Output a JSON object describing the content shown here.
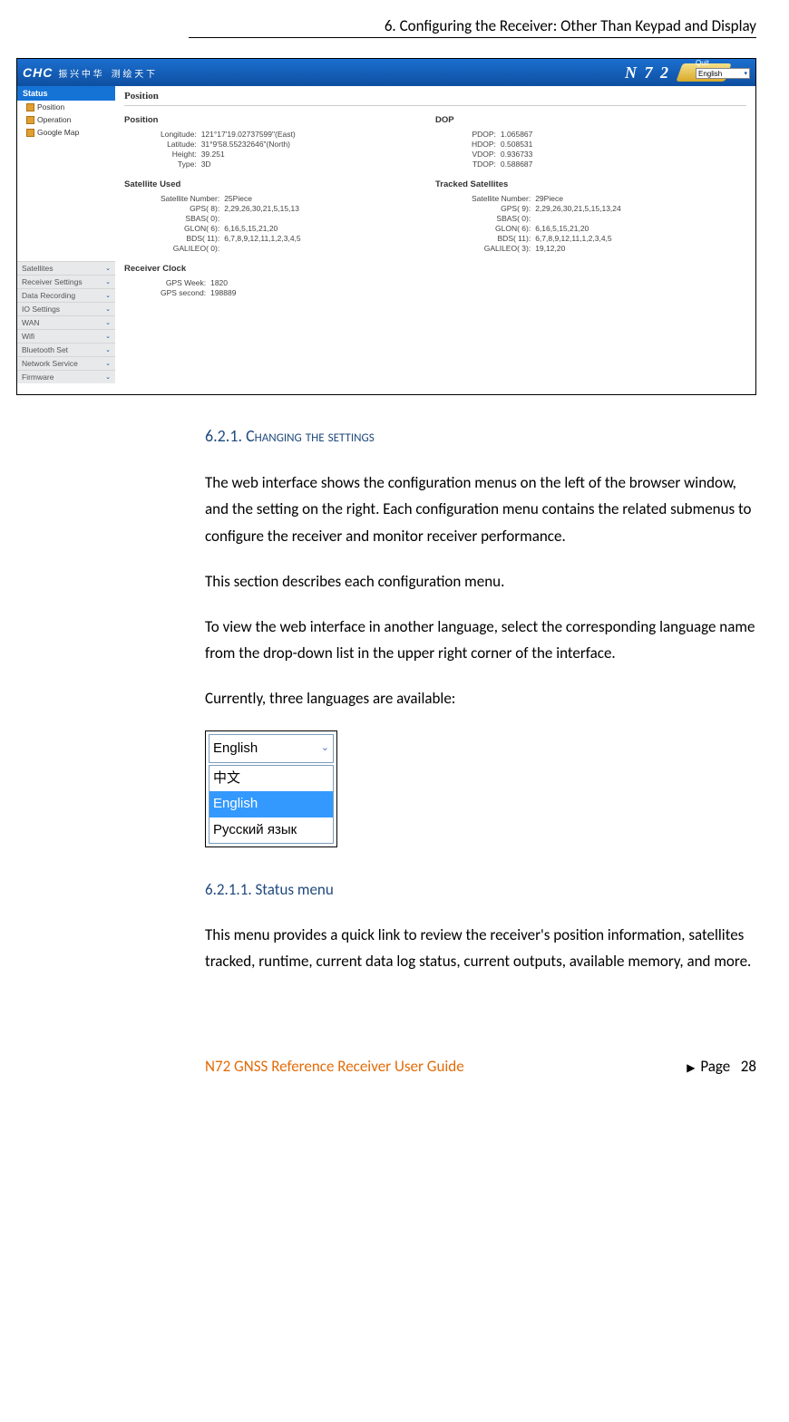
{
  "header": {
    "chapter": "6. Configuring the Receiver: Other Than Keypad and Display"
  },
  "screenshot": {
    "brand": "CHC",
    "tagline": "振 兴 中 华　测 绘 天 下",
    "model": "N 7 2",
    "quit": "Quit",
    "lang_selected": "English",
    "sidebar": {
      "active": "Status",
      "subs": [
        "Position",
        "Operation",
        "Google Map"
      ],
      "items": [
        "Satellites",
        "Receiver Settings",
        "Data Recording",
        "IO Settings",
        "WAN",
        "Wifi",
        "Bluetooth Set",
        "Network Service",
        "Firmware"
      ]
    },
    "main": {
      "title": "Position",
      "position": {
        "title": "Position",
        "rows": [
          [
            "Longitude:",
            "121°17'19.02737599\"(East)"
          ],
          [
            "Latitude:",
            "31°9'58.55232646\"(North)"
          ],
          [
            "Height:",
            "39.251"
          ],
          [
            "Type:",
            "3D"
          ]
        ]
      },
      "dop": {
        "title": "DOP",
        "rows": [
          [
            "PDOP:",
            "1.065867"
          ],
          [
            "HDOP:",
            "0.508531"
          ],
          [
            "VDOP:",
            "0.936733"
          ],
          [
            "TDOP:",
            "0.588687"
          ]
        ]
      },
      "sat_used": {
        "title": "Satellite Used",
        "rows": [
          [
            "Satellite Number:",
            "25Piece"
          ],
          [
            "GPS( 8):",
            "2,29,26,30,21,5,15,13"
          ],
          [
            "SBAS( 0):",
            ""
          ],
          [
            "GLON( 6):",
            "6,16,5,15,21,20"
          ],
          [
            "BDS( 11):",
            "6,7,8,9,12,11,1,2,3,4,5"
          ],
          [
            "GALILEO( 0):",
            ""
          ]
        ]
      },
      "sat_tracked": {
        "title": "Tracked  Satellites",
        "rows": [
          [
            "Satellite Number:",
            "29Piece"
          ],
          [
            "GPS( 9):",
            "2,29,26,30,21,5,15,13,24"
          ],
          [
            "SBAS( 0):",
            ""
          ],
          [
            "GLON( 6):",
            "6,16,5,15,21,20"
          ],
          [
            "BDS( 11):",
            "6,7,8,9,12,11,1,2,3,4,5"
          ],
          [
            "GALILEO( 3):",
            "19,12,20"
          ]
        ]
      },
      "clock": {
        "title": "Receiver Clock",
        "rows": [
          [
            "GPS Week:",
            "1820"
          ],
          [
            "GPS second:",
            "198889"
          ]
        ]
      }
    }
  },
  "sections": {
    "h3_num": "6.2.1. ",
    "h3_text": "Changing the settings",
    "p1": "The web interface shows the configuration menus on the left of the browser window, and the setting on the right. Each configuration menu contains the related submenus to configure the receiver and monitor receiver performance.",
    "p2": "This section describes each configuration menu.",
    "p3": "To view the web interface in another language, select the corresponding language name from the drop-down list in the upper right corner of the interface.",
    "p4": "Currently, three languages are available:",
    "lang_dd": {
      "selected": "English",
      "options": [
        "中文",
        "English",
        "Русский язык"
      ]
    },
    "h4": "6.2.1.1. Status menu",
    "p5": "This menu provides a quick link to review the receiver's position information, satellites tracked, runtime, current data log status, current outputs, available memory, and more."
  },
  "footer": {
    "guide": "N72 GNSS Reference Receiver User Guide",
    "page_label": "Page",
    "page_num": "28"
  }
}
